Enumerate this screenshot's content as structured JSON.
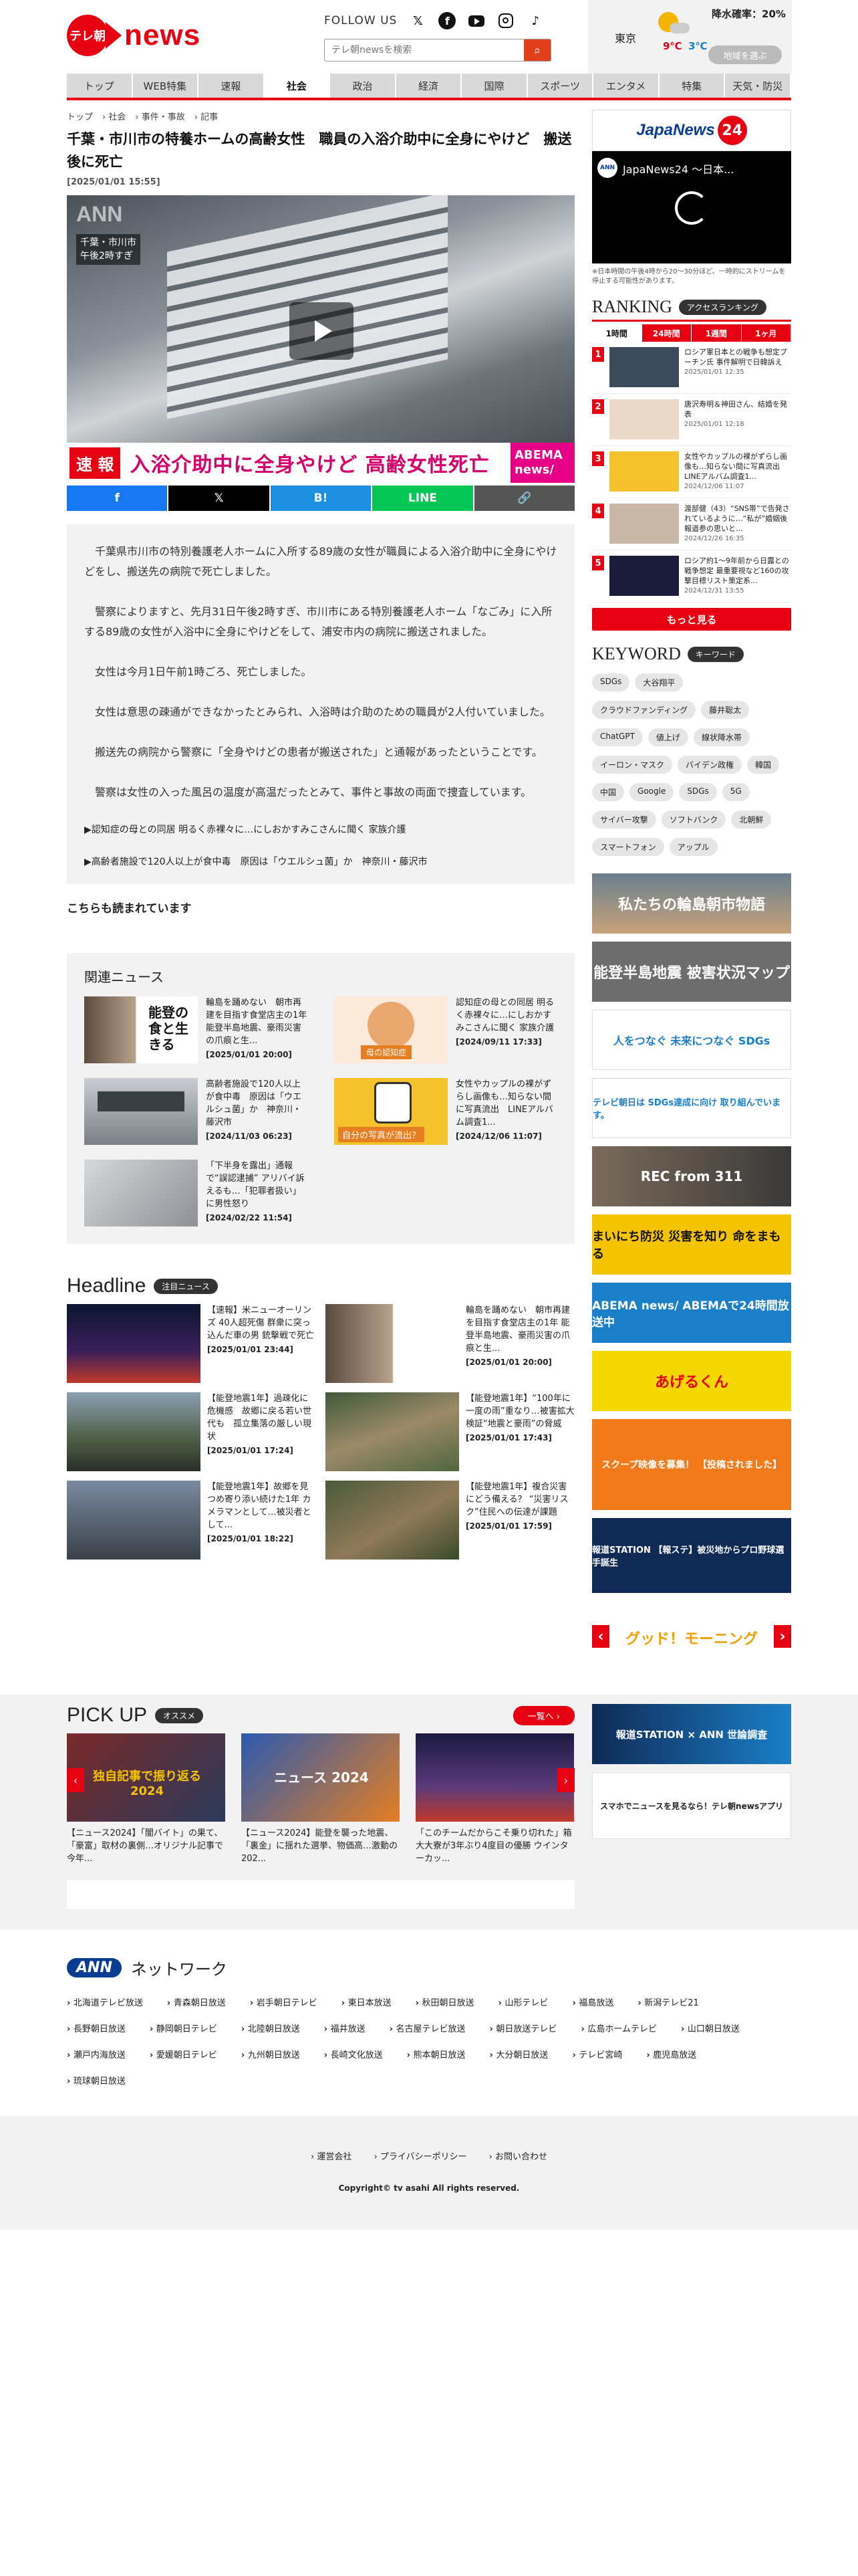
{
  "header": {
    "logo_badge": "テレ朝",
    "logo_word": "news",
    "follow_label": "FOLLOW US",
    "search_placeholder": "テレ朝newsを検索",
    "weather": {
      "city": "東京",
      "high": "9℃",
      "low": "3℃",
      "rain_label": "降水確率：20%",
      "rain_value": "",
      "pick_region": "地域を選ぶ"
    }
  },
  "nav": [
    "トップ",
    "WEB特集",
    "速報",
    "社会",
    "政治",
    "経済",
    "国際",
    "スポーツ",
    "エンタメ",
    "特集",
    "天気・防災"
  ],
  "nav_active": 3,
  "breadcrumb": [
    "トップ",
    "社会",
    "事件・事故",
    "記事"
  ],
  "article": {
    "title": "千葉・市川市の特養ホームの高齢女性　職員の入浴介助中に全身にやけど　搬送後に死亡",
    "date": "[2025/01/01 15:55]",
    "video": {
      "watermark": "ANN",
      "timestamp_1": "千葉・市川市",
      "timestamp_2": "午後2時すぎ",
      "flash": "速 報",
      "caption": "入浴介助中に全身やけど 高齢女性死亡",
      "abema": "ABEMA news/"
    },
    "share": [
      "f",
      "𝕏",
      "B!",
      "LINE",
      "🔗"
    ],
    "paragraphs": [
      "　千葉県市川市の特別養護老人ホームに入所する89歳の女性が職員による入浴介助中に全身にやけどをし、搬送先の病院で死亡しました。",
      "　警察によりますと、先月31日午後2時すぎ、市川市にある特別養護老人ホーム「なごみ」に入所する89歳の女性が入浴中に全身にやけどをして、浦安市内の病院に搬送されました。",
      "　女性は今月1日午前1時ごろ、死亡しました。",
      "　女性は意思の疎通ができなかったとみられ、入浴時は介助のための職員が2人付いていました。",
      "　搬送先の病院から警察に「全身やけどの患者が搬送された」と通報があったということです。",
      "　警察は女性の入った風呂の温度が高温だったとみて、事件と事故の両面で捜査しています。"
    ],
    "related_links": [
      "▶認知症の母との同居 明るく赤裸々に…にしおかすみこさんに聞く 家族介護",
      "▶高齢者施設で120人以上が食中毒　原因は「ウエルシュ菌」か　神奈川・藤沢市"
    ],
    "also_read": "こちらも読まれています"
  },
  "related_news": {
    "title": "関連ニュース",
    "items": [
      {
        "text": "輪島を踊めない　朝市再建を目指す食堂店主の1年 能登半島地震、豪雨災害の爪痕と生...",
        "date": "[2025/01/01 20:00]"
      },
      {
        "text": "認知症の母との同居 明るく赤裸々に…にしおかすみこさんに聞く 家族介護",
        "date": "[2024/09/11 17:33]"
      },
      {
        "text": "高齢者施設で120人以上が食中毒　原因は「ウエルシュ菌」か　神奈川・藤沢市",
        "date": "[2024/11/03 06:23]"
      },
      {
        "text": "女性やカップルの裸がずらし画像も…知らない間に写真流出　LINEアルバム調査1...",
        "date": "[2024/12/06 11:07]"
      },
      {
        "text": "「下半身を露出」通報で“誤認逮捕” アリバイ訴えるも…「犯罪者扱い」に男性怒り",
        "date": "[2024/02/22 11:54]"
      }
    ],
    "thumb_overlay_1": "能登の食と生きる",
    "thumb_overlay_2": "母の認知症",
    "thumb_overlay_4": "自分の写真が流出？"
  },
  "headline": {
    "title": "Headline",
    "pill": "注目ニュース",
    "items": [
      {
        "text": "【速報】米ニューオーリンズ 40人超死傷 群衆に突っ込んだ車の男 銃撃戦で死亡",
        "date": "[2025/01/01 23:44]"
      },
      {
        "text": "輪島を踊めない　朝市再建を目指す食堂店主の1年 能登半島地震、豪雨災害の爪痕と生...",
        "date": "[2025/01/01 20:00]"
      },
      {
        "text": "【能登地震1年】過疎化に危機感　故郷に戻る若い世代も　孤立集落の厳しい現状",
        "date": "[2025/01/01 17:24]"
      },
      {
        "text": "【能登地震1年】“100年に一度の雨”重なり…被害拡大 検証“地震と豪雨”の脅威",
        "date": "[2025/01/01 17:43]"
      },
      {
        "text": "【能登地震1年】故郷を見つめ寄り添い続けた1年 カメラマンとして…被災者として...",
        "date": "[2025/01/01 18:22]"
      },
      {
        "text": "【能登地震1年】複合災害にどう備える？ “災害リスク”住民への伝達が課題",
        "date": "[2025/01/01 17:59]"
      }
    ]
  },
  "pickup": {
    "title": "PICK UP",
    "pill": "オススメ",
    "more": "一覧へ ›",
    "items": [
      {
        "text": "【ニュース2024】「闇バイト」の果て、「豪富」取材の裏側…オリジナル記事で今年...",
        "overlay": "独自記事で振り返る 2024"
      },
      {
        "text": "【ニュース2024】能登を襲った地震、「裏金」に揺れた選挙、物価高…激動の202...",
        "overlay": "ニュース 2024"
      },
      {
        "text": "「このチームだからこそ乗り切れた」箱大大寮が3年ぶり4度目の優勝 ウインターカッ...",
        "overlay": ""
      }
    ]
  },
  "sidebar": {
    "japannews": "JapaNews",
    "japannews_num": "24",
    "live_title": "JapaNews24 ～日本...",
    "live_badge": "ANN",
    "live_note": "※日本時間の午後4時から20～30分ほど、一時的にストリームを停止する可能性があります。",
    "ranking_title": "RANKING",
    "ranking_pill": "アクセスランキング",
    "ranking_tabs": [
      "1時間",
      "24時間",
      "1週間",
      "1ヶ月"
    ],
    "ranking": [
      {
        "n": "1",
        "text": "ロシア軍日本との戦争も想定プーチン氏 事件解明で日韓訴え",
        "date": "2025/01/01 12:35"
      },
      {
        "n": "2",
        "text": "唐沢寿明＆神田さん、結婚を発表",
        "date": "2025/01/01 12:18"
      },
      {
        "n": "3",
        "text": "女性やカップルの裸がずらし画像も…知らない間に写真流出　LINEアルバム調査1...",
        "date": "2024/12/06 11:07"
      },
      {
        "n": "4",
        "text": "渡部健（43）“SNS帯”で告発されているように…“私が”婚姻後報道参の思いと...",
        "date": "2024/12/26 16:35"
      },
      {
        "n": "5",
        "text": "ロシア約1～9年前から日露との戦争想定 最重要視など160の攻撃目標リスト策定系...",
        "date": "2024/12/31 13:55"
      }
    ],
    "ranking_more": "もっと見る",
    "keyword_title": "KEYWORD",
    "keyword_pill": "キーワード",
    "keywords": [
      "SDGs",
      "大谷翔平",
      "クラウドファンディング",
      "藤井聡太",
      "ChatGPT",
      "値上げ",
      "線状降水帯",
      "イーロン・マスク",
      "バイデン政権",
      "韓国",
      "中国",
      "Google",
      "SDGs",
      "5G",
      "サイバー攻撃",
      "ソフトバンク",
      "北朝鮮",
      "スマートフォン",
      "アップル"
    ],
    "banners": [
      {
        "text": "私たちの輪島朝市物語"
      },
      {
        "text": "能登半島地震 被害状況マップ"
      },
      {
        "text": "人をつなぐ 未来につなぐ SDGs"
      },
      {
        "text": "テレビ朝日は SDGs達成に向け 取り組んでいます。"
      },
      {
        "text": "REC from 311"
      },
      {
        "text": "まいにち防災 災害を知り 命をまもる"
      },
      {
        "text": "ABEMA news/ ABEMAで24時間放送中"
      },
      {
        "text": "あげるくん"
      },
      {
        "text": "スクープ映像を募集！ 【投稿されました】"
      },
      {
        "text": "報道STATION 【報ステ】被災地からプロ野球選手誕生"
      },
      {
        "text": "グッド！モーニング"
      },
      {
        "text": "報道STATION × ANN 世論調査"
      },
      {
        "text": "スマホでニュースを見るなら！テレ朝newsアプリ"
      }
    ]
  },
  "ann": {
    "logo": "ANN",
    "title": "ネットワーク",
    "stations": [
      "北海道テレビ放送",
      "青森朝日放送",
      "岩手朝日テレビ",
      "東日本放送",
      "秋田朝日放送",
      "山形テレビ",
      "福島放送",
      "新潟テレビ21",
      "長野朝日放送",
      "静岡朝日テレビ",
      "北陸朝日放送",
      "福井放送",
      "名古屋テレビ放送",
      "朝日放送テレビ",
      "広島ホームテレビ",
      "山口朝日放送",
      "瀬戸内海放送",
      "愛媛朝日テレビ",
      "九州朝日放送",
      "長崎文化放送",
      "熊本朝日放送",
      "大分朝日放送",
      "テレビ宮崎",
      "鹿児島放送",
      "琉球朝日放送"
    ]
  },
  "footer": {
    "links": [
      "運営会社",
      "プライバシーポリシー",
      "お問い合わせ"
    ],
    "copyright": "Copyright© tv asahi All rights reserved."
  },
  "colors": {
    "brand": "#e60012",
    "ann": "#0a3d91"
  }
}
